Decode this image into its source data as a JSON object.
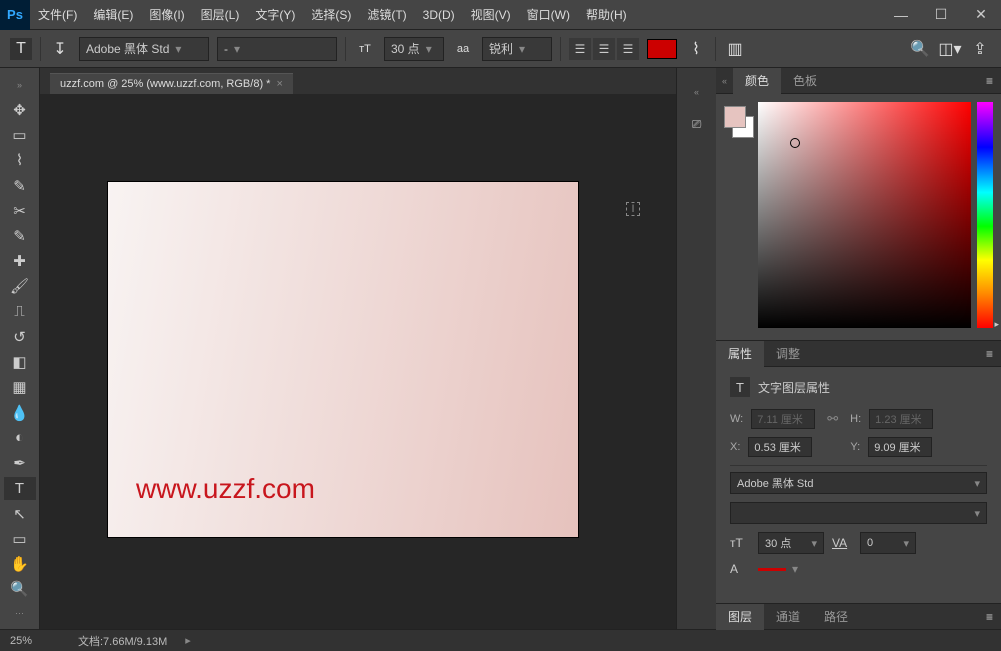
{
  "menubar": {
    "logo": "Ps",
    "items": [
      "文件(F)",
      "编辑(E)",
      "图像(I)",
      "图层(L)",
      "文字(Y)",
      "选择(S)",
      "滤镜(T)",
      "3D(D)",
      "视图(V)",
      "窗口(W)",
      "帮助(H)"
    ]
  },
  "options": {
    "font": "Adobe 黑体 Std",
    "font_style": "-",
    "size": "30 点",
    "aa_label": "aa",
    "aa_mode": "锐利",
    "text_color": "#cc0000"
  },
  "document": {
    "tab": "uzzf.com @ 25% (www.uzzf.com, RGB/8) *",
    "canvas_text": "www.uzzf.com"
  },
  "panels": {
    "color_tab": "颜色",
    "swatches_tab": "色板",
    "props_tab": "属性",
    "adjust_tab": "调整",
    "props_title": "文字图层属性",
    "w_label": "W:",
    "w_value": "7.11 厘米",
    "h_label": "H:",
    "h_value": "1.23 厘米",
    "x_label": "X:",
    "x_value": "0.53 厘米",
    "y_label": "Y:",
    "y_value": "9.09 厘米",
    "font_value": "Adobe 黑体 Std",
    "style_value": "",
    "size_value": "30 点",
    "tracking_value": "0",
    "layers_tab": "图层",
    "channels_tab": "通道",
    "paths_tab": "路径"
  },
  "status": {
    "zoom": "25%",
    "doc_info": "文档:7.66M/9.13M"
  }
}
